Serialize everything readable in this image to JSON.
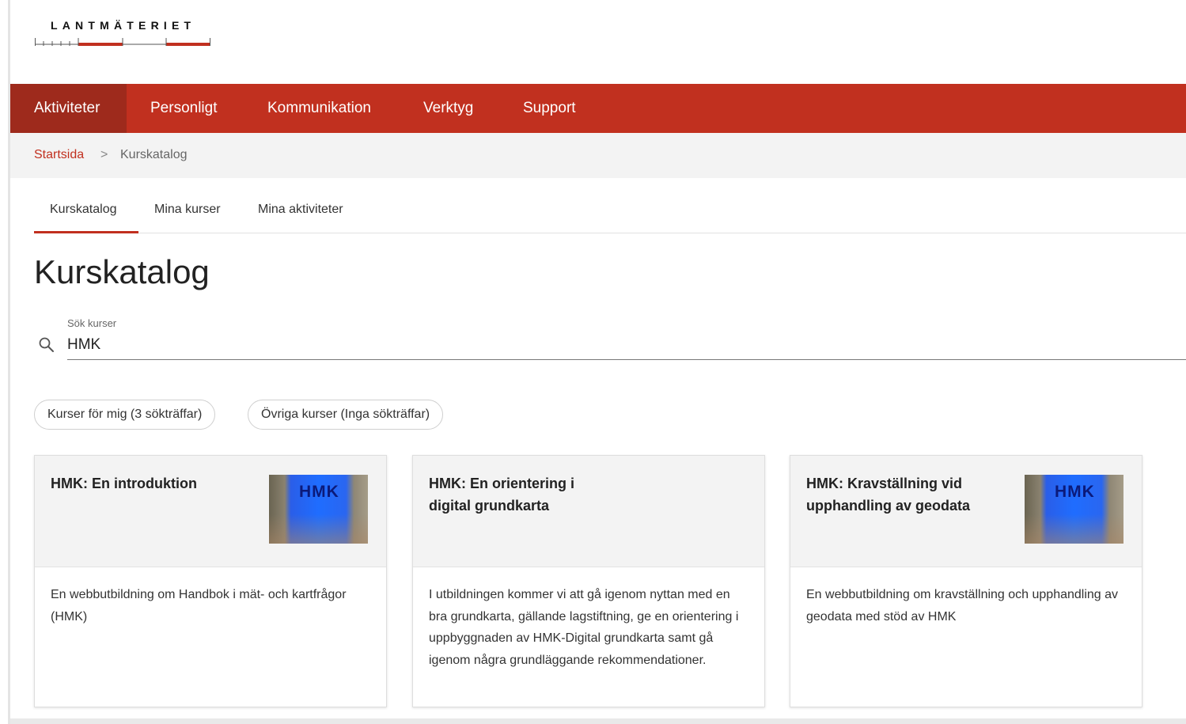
{
  "brand": {
    "logo_text": "LANTMÄTERIET"
  },
  "nav": {
    "items": [
      {
        "label": "Aktiviteter",
        "active": true
      },
      {
        "label": "Personligt"
      },
      {
        "label": "Kommunikation"
      },
      {
        "label": "Verktyg"
      },
      {
        "label": "Support"
      }
    ]
  },
  "breadcrumb": {
    "home": "Startsida",
    "separator": ">",
    "current": "Kurskatalog"
  },
  "tabs": [
    {
      "label": "Kurskatalog",
      "active": true
    },
    {
      "label": "Mina kurser"
    },
    {
      "label": "Mina aktiviteter"
    }
  ],
  "page": {
    "title": "Kurskatalog"
  },
  "search": {
    "label": "Sök kurser",
    "value": "HMK"
  },
  "filters": [
    {
      "label": "Kurser för mig (3 sökträffar)"
    },
    {
      "label": "Övriga kurser (Inga sökträffar)"
    }
  ],
  "courses": [
    {
      "title": "HMK: En introduktion",
      "thumbnail_text": "HMK",
      "description": "En webbutbildning om Handbok i mät- och kartfrågor (HMK)"
    },
    {
      "title": "HMK: En orientering i digital grundkarta",
      "description": "I utbildningen kommer vi att gå igenom nyttan med en bra grundkarta, gällande lagstiftning, ge en orientering i uppbyggnaden av HMK-Digital grundkarta samt gå igenom några grundläggande rekommendationer."
    },
    {
      "title": "HMK: Kravställning vid upphandling av geodata",
      "thumbnail_text": "HMK",
      "description": "En webbutbildning om kravställning och upphandling av geodata med stöd av HMK"
    }
  ],
  "colors": {
    "brand_red": "#c1301f",
    "nav_active": "#9e2a1c",
    "crumb_bg": "#f3f3f3"
  }
}
